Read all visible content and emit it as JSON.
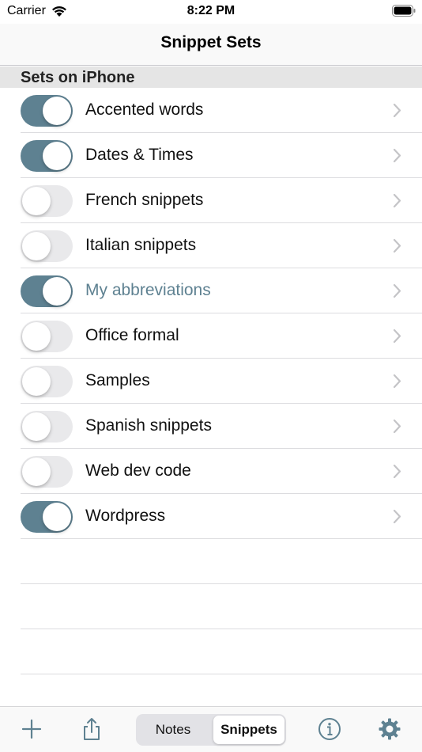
{
  "status_bar": {
    "carrier": "Carrier",
    "time": "8:22 PM"
  },
  "nav": {
    "title": "Snippet Sets"
  },
  "section": {
    "title": "Sets on iPhone"
  },
  "sets": [
    {
      "label": "Accented words",
      "enabled": true
    },
    {
      "label": "Dates & Times",
      "enabled": true
    },
    {
      "label": "French snippets",
      "enabled": false
    },
    {
      "label": "Italian snippets",
      "enabled": false
    },
    {
      "label": "My abbreviations",
      "enabled": true,
      "highlighted": true
    },
    {
      "label": "Office formal",
      "enabled": false
    },
    {
      "label": "Samples",
      "enabled": false
    },
    {
      "label": "Spanish snippets",
      "enabled": false
    },
    {
      "label": "Web dev code",
      "enabled": false
    },
    {
      "label": "Wordpress",
      "enabled": true
    }
  ],
  "toolbar": {
    "segments": [
      "Notes",
      "Snippets"
    ],
    "selected_segment": "Snippets",
    "icons": [
      "plus-icon",
      "share-icon",
      "info-icon",
      "gear-icon"
    ]
  },
  "colors": {
    "accent": "#5e8191",
    "toggle_off": "#e9e9eb"
  }
}
